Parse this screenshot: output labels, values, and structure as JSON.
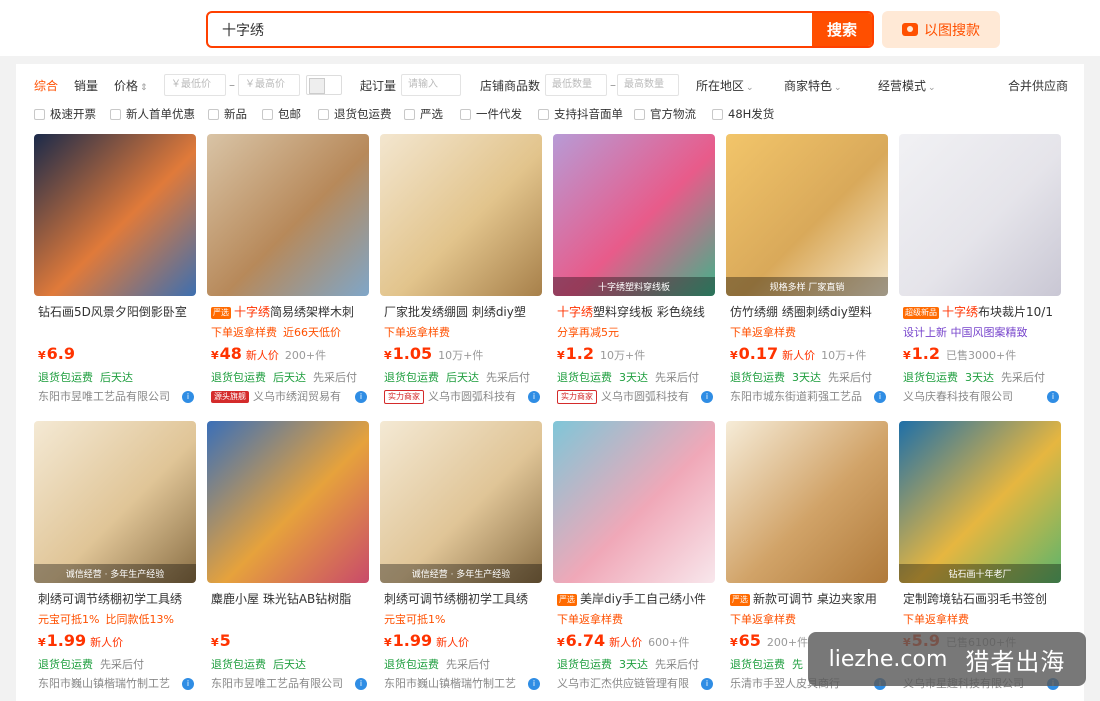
{
  "search": {
    "value": "十字绣",
    "button_label": "搜索",
    "image_search_label": "以图搜款"
  },
  "filters": {
    "sort_default": "综合",
    "sort_sales": "销量",
    "sort_price": "价格",
    "price_min_placeholder": "￥最低价",
    "price_max_placeholder": "￥最高价",
    "range_dash": "–",
    "moq_label": "起订量",
    "moq_placeholder": "请输入",
    "shop_count_label": "店铺商品数",
    "shop_min_placeholder": "最低数量",
    "shop_max_placeholder": "最高数量",
    "region": "所在地区",
    "features": "商家特色",
    "mode": "经营模式",
    "merge": "合并供应商",
    "checkboxes": [
      "极速开票",
      "新人首单优惠",
      "新品",
      "包邮",
      "退货包运费",
      "严选",
      "一件代发",
      "支持抖音面单",
      "官方物流",
      "48H发货"
    ]
  },
  "products": [
    {
      "image_label": "",
      "title_tag": "",
      "title_hl": "",
      "title": "钻石画5D风景夕阳倒影卧室",
      "sub1": "",
      "sub2": "",
      "price": "6.9",
      "newbie": "",
      "sold": "",
      "svc1": "退货包运费",
      "svc2": "后天达",
      "svc3": "",
      "badge": "",
      "shop": "东阳市昱唯工艺品有限公司",
      "colors": [
        "#1b2a4a",
        "#e07a3a",
        "#3d6fb0"
      ]
    },
    {
      "image_label": "",
      "title_tag": "严选",
      "title_hl": "十字绣",
      "title": "简易绣架榉木刺",
      "sub1": "下单返拿样费",
      "sub2": "近66天低价",
      "price": "48",
      "newbie": "新人价",
      "sold": "200+件",
      "svc1": "退货包运费",
      "svc2": "后天达",
      "svc3": "先采后付",
      "badge": "源头旗舰",
      "shop": "义乌市绣润贸易有",
      "colors": [
        "#d9c4a6",
        "#b7895a",
        "#7fa6c8"
      ]
    },
    {
      "image_label": "",
      "title_tag": "",
      "title_hl": "",
      "title": "厂家批发绣绷圆 刺绣diy塑",
      "sub1": "下单返拿样费",
      "sub2": "",
      "price": "1.05",
      "newbie": "",
      "sold": "10万+件",
      "svc1": "退货包运费",
      "svc2": "后天达",
      "svc3": "先采后付",
      "badge": "实力商家",
      "shop": "义乌市圆弧科技有",
      "colors": [
        "#f3e6cf",
        "#e2c48c",
        "#a7804a"
      ]
    },
    {
      "image_label": "十字绣塑料穿线板",
      "title_tag": "",
      "title_hl": "十字绣",
      "title": "塑料穿线板 彩色绕线",
      "sub1": "分享再减5元",
      "sub2": "",
      "price": "1.2",
      "newbie": "",
      "sold": "10万+件",
      "svc1": "退货包运费",
      "svc2": "3天达",
      "svc3": "先采后付",
      "badge": "实力商家",
      "shop": "义乌市圆弧科技有",
      "colors": [
        "#b79bd6",
        "#e85b8a",
        "#3fb38a"
      ]
    },
    {
      "image_label": "规格多样 厂家直销",
      "title_tag": "",
      "title_hl": "",
      "title": "仿竹绣绷 绣圈刺绣diy塑料",
      "sub1": "下单返拿样费",
      "sub2": "",
      "price": "0.17",
      "newbie": "新人价",
      "sold": "10万+件",
      "svc1": "退货包运费",
      "svc2": "3天达",
      "svc3": "先采后付",
      "badge": "",
      "shop": "东阳市城东街道莉强工艺品",
      "colors": [
        "#f2c56a",
        "#d9a95a",
        "#f6e9cf"
      ]
    },
    {
      "image_label": "",
      "title_tag": "超级新品",
      "title_hl": "十字绣",
      "title": "布块裁片10/1",
      "sub1": "设计上新 中国风图案精致",
      "sub2": "",
      "price": "1.2",
      "newbie": "",
      "sold": "已售3000+件",
      "svc1": "退货包运费",
      "svc2": "3天达",
      "svc3": "先采后付",
      "badge": "",
      "shop": "义乌庆春科技有限公司",
      "colors": [
        "#f1f1f4",
        "#e5e4ea",
        "#c9c7d4"
      ]
    },
    {
      "image_label": "诚信经营 · 多年生产经验",
      "title_tag": "",
      "title_hl": "",
      "title": "刺绣可调节绣棚初学工具绣",
      "sub1": "元宝可抵1%",
      "sub2": "比同款低13%",
      "price": "1.99",
      "newbie": "新人价",
      "sold": "",
      "svc1": "退货包运费",
      "svc2": "",
      "svc3": "先采后付",
      "badge": "",
      "shop": "东阳市巍山镇楷瑞竹制工艺",
      "colors": [
        "#f4e9d4",
        "#e0c597",
        "#8a6f45"
      ]
    },
    {
      "image_label": "",
      "title_tag": "",
      "title_hl": "",
      "title": "麋鹿小屋 珠光钻AB钻树脂",
      "sub1": "",
      "sub2": "",
      "price": "5",
      "newbie": "",
      "sold": "",
      "svc1": "退货包运费",
      "svc2": "后天达",
      "svc3": "",
      "badge": "",
      "shop": "东阳市昱唯工艺品有限公司",
      "colors": [
        "#3a6fb8",
        "#e6a23c",
        "#c94a6a"
      ]
    },
    {
      "image_label": "诚信经营 · 多年生产经验",
      "title_tag": "",
      "title_hl": "",
      "title": "刺绣可调节绣棚初学工具绣",
      "sub1": "元宝可抵1%",
      "sub2": "",
      "price": "1.99",
      "newbie": "新人价",
      "sold": "",
      "svc1": "退货包运费",
      "svc2": "",
      "svc3": "先采后付",
      "badge": "",
      "shop": "东阳市巍山镇楷瑞竹制工艺",
      "colors": [
        "#f4e9d4",
        "#e0c597",
        "#8a6f45"
      ]
    },
    {
      "image_label": "",
      "title_tag": "严选",
      "title_hl": "",
      "title": "美岸diy手工自己绣小件",
      "sub1": "下单返拿样费",
      "sub2": "",
      "price": "6.74",
      "newbie": "新人价",
      "sold": "600+件",
      "svc1": "退货包运费",
      "svc2": "3天达",
      "svc3": "先采后付",
      "badge": "",
      "shop": "义乌市汇杰供应链管理有限",
      "colors": [
        "#7fc6d8",
        "#f0a8b8",
        "#f8e7ec"
      ]
    },
    {
      "image_label": "",
      "title_tag": "严选",
      "title_hl": "",
      "title": "新款可调节 桌边夹家用",
      "sub1": "下单返拿样费",
      "sub2": "",
      "price": "65",
      "newbie": "",
      "sold": "200+件",
      "svc1": "退货包运费",
      "svc2": "先",
      "svc3": "",
      "badge": "",
      "shop": "乐清市手翌人皮具商行",
      "colors": [
        "#f6ecd8",
        "#d1a368",
        "#b07a3a"
      ]
    },
    {
      "image_label": "钻石画十年老厂",
      "title_tag": "",
      "title_hl": "",
      "title": "定制跨境钻石画羽毛书签创",
      "sub1": "下单返拿样费",
      "sub2": "",
      "price": "5.9",
      "newbie": "",
      "sold": "已售6100+件",
      "svc1": "",
      "svc2": "",
      "svc3": "",
      "badge": "",
      "shop": "义乌市星趣科技有限公司",
      "colors": [
        "#1e6fa8",
        "#e6b640",
        "#5bb56c"
      ]
    }
  ],
  "watermark": {
    "site": "liezhe.com",
    "cn": "猎者出海"
  }
}
